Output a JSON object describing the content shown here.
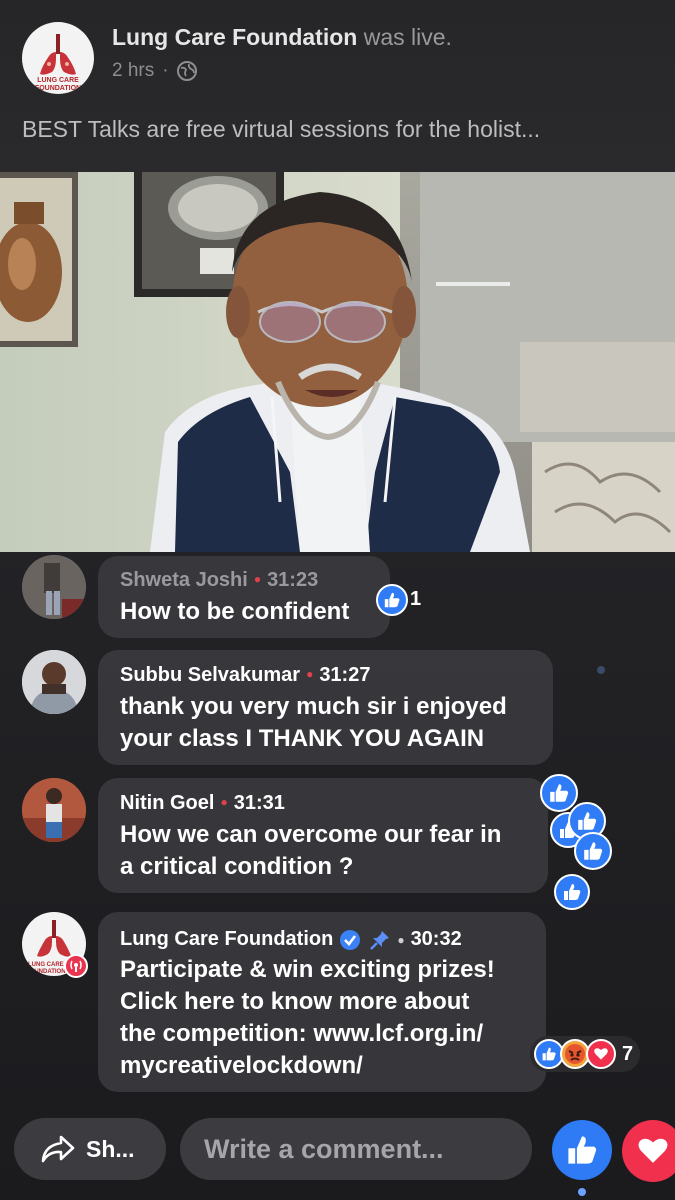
{
  "header": {
    "page_name": "Lung Care Foundation",
    "status": "was live.",
    "time": "2 hrs",
    "separator": "·",
    "privacy_icon": "globe-icon",
    "description": "BEST Talks are free virtual sessions for the holist...",
    "avatar_logo_text": [
      "LUNG CARE",
      "FOUNDATION"
    ]
  },
  "comments": [
    {
      "name": "Shweta Joshi",
      "time": "31:23",
      "text": [
        "How to be confident"
      ],
      "reaction_count": "1"
    },
    {
      "name": "Subbu Selvakumar",
      "time": "31:27",
      "text": [
        "thank you very much sir i enjoyed",
        "your class I THANK YOU AGAIN"
      ]
    },
    {
      "name": "Nitin Goel",
      "time": "31:31",
      "text": [
        "How we can overcome our fear in",
        "a critical condition ?"
      ]
    },
    {
      "name": "Lung Care Foundation",
      "time": "30:32",
      "verified": true,
      "pinned": true,
      "text": [
        "Participate & win exciting prizes!",
        "Click here to know more about",
        "the competition: www.lcf.org.in/",
        "mycreativelockdown/"
      ],
      "reaction_count": "7",
      "reactions": [
        "like",
        "angry",
        "love"
      ]
    }
  ],
  "bottom_bar": {
    "share_label": "Sh...",
    "comment_placeholder": "Write a comment..."
  },
  "colors": {
    "like_blue": "#2f7cf6",
    "love_red": "#f0304d",
    "live_dot": "#e0414b"
  }
}
